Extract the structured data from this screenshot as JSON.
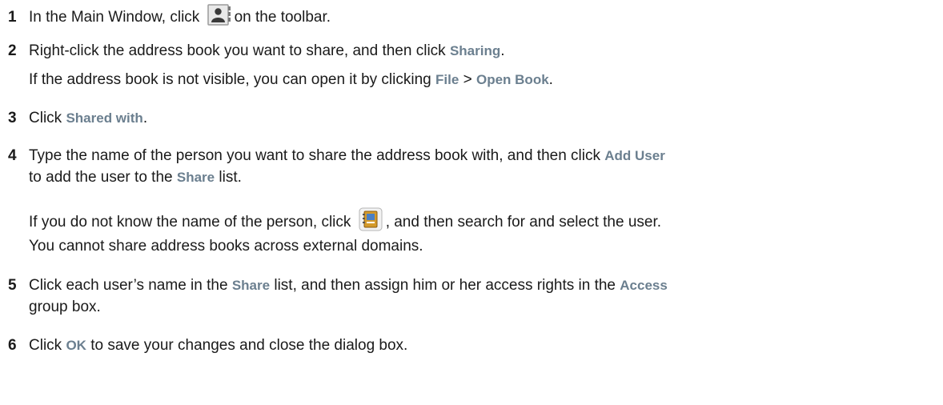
{
  "steps": [
    {
      "number": "1",
      "t1": "In the Main Window, click",
      "icon": "address-book-toolbar-icon",
      "t2": "on the toolbar."
    },
    {
      "number": "2",
      "t1": "Right-click the address book you want to share, and then click",
      "ui1": "Sharing",
      "t2": ".",
      "note": {
        "t1": "If the address book is not visible, you can open it by clicking",
        "ui1": "File",
        "sep": ">",
        "ui2": "Open Book",
        "t2": "."
      }
    },
    {
      "number": "3",
      "t1": "Click",
      "ui1": "Shared with",
      "t2": "."
    },
    {
      "number": "4",
      "t1": "Type the name of the person you want to share the address book with, and then click",
      "ui1": "Add User",
      "t2": "to add the user to the",
      "ui2": "Share",
      "t3": "list.",
      "note1": {
        "t1": "If you do not know the name of the person, click",
        "icon": "address-selector-icon",
        "t2": ", and then search for and select the user."
      },
      "note2": "You cannot share address books across external domains."
    },
    {
      "number": "5",
      "t1": "Click each user’s name in the",
      "ui1": "Share",
      "t2": "list, and then assign him or her access rights in the",
      "ui2": "Access",
      "t3": "group box."
    },
    {
      "number": "6",
      "t1": "Click",
      "ui1": "OK",
      "t2": "to save your changes and close the dialog box."
    }
  ],
  "colors": {
    "text": "#1a1a1a",
    "ui_term": "#6b7f8f"
  }
}
